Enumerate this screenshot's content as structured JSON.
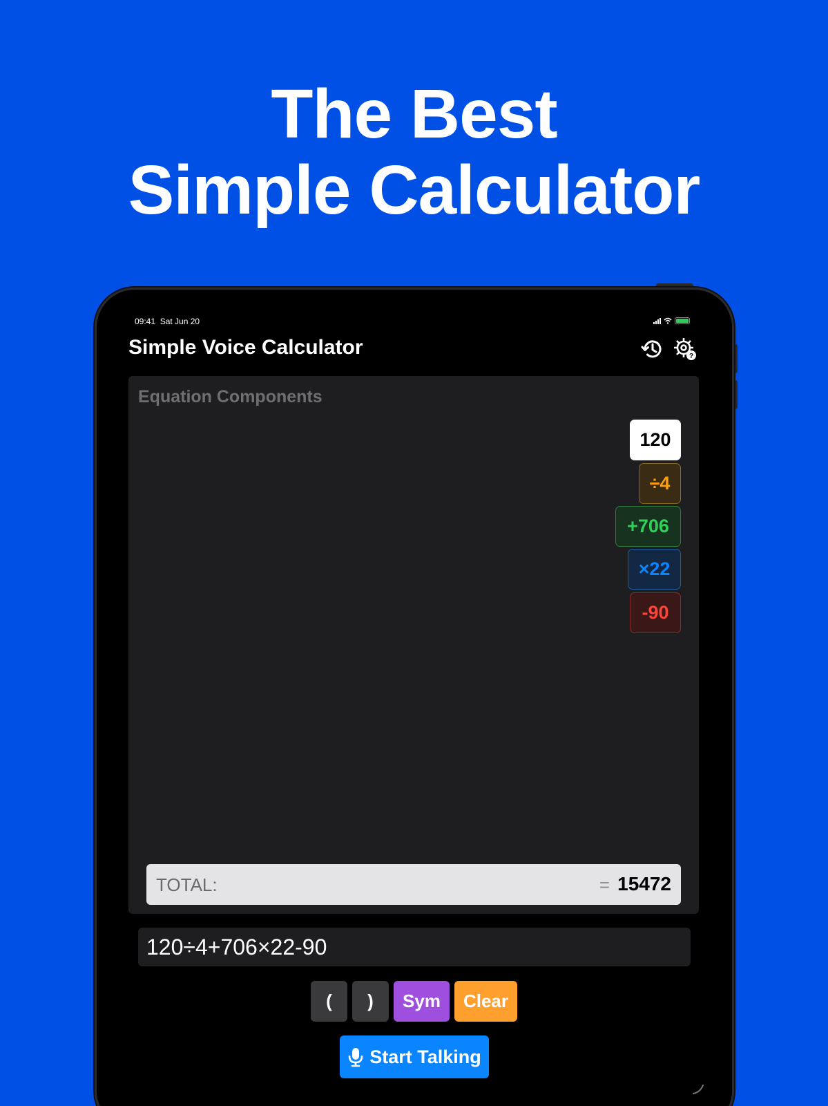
{
  "headline": {
    "line1": "The Best",
    "line2": "Simple Calculator"
  },
  "status_bar": {
    "time": "09:41",
    "date": "Sat Jun 20"
  },
  "app": {
    "title": "Simple Voice Calculator"
  },
  "icons": {
    "history": "history-clock-icon",
    "settings": "settings-help-gear-icon",
    "mic": "microphone-icon"
  },
  "panel": {
    "title": "Equation Components",
    "chips": [
      {
        "label": "120",
        "kind": "number",
        "color": "#000000",
        "bg": "#ffffff",
        "border": "#ffffff"
      },
      {
        "label": "÷4",
        "kind": "divide",
        "color": "#ff9f0a",
        "bg": "#3a2c14",
        "border": "#8a6a1c"
      },
      {
        "label": "+706",
        "kind": "add",
        "color": "#30d158",
        "bg": "#17331f",
        "border": "#2b7a3b"
      },
      {
        "label": "×22",
        "kind": "multiply",
        "color": "#0a84ff",
        "bg": "#122843",
        "border": "#1d5da0"
      },
      {
        "label": "-90",
        "kind": "subtract",
        "color": "#ff453a",
        "bg": "#3a1818",
        "border": "#8a2a2a"
      }
    ]
  },
  "total": {
    "label": "TOTAL:",
    "equals": "=",
    "value": "15472"
  },
  "equation": {
    "text": "120÷4+706×22-90"
  },
  "buttons": {
    "open_paren": "(",
    "close_paren": ")",
    "sym": "Sym",
    "clear": "Clear",
    "talk": "Start Talking"
  },
  "colors": {
    "background": "#0050e6",
    "sym": "#9f4fde",
    "clear": "#ff9f2e",
    "paren": "#3a3a3c",
    "talk": "#0a84ff"
  }
}
